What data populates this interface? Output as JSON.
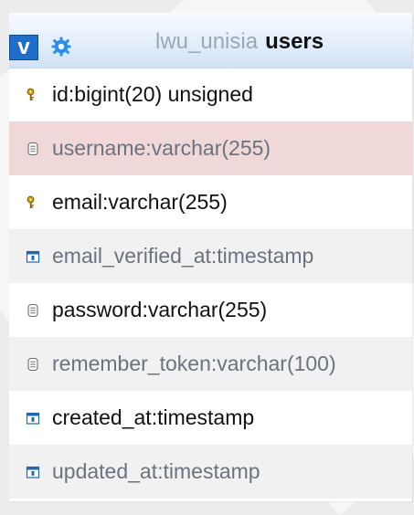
{
  "table": {
    "toggle_label": "v",
    "database": "lwu_unisia",
    "name": "users",
    "header_color": "#2b78d5",
    "primary_key_icon": "key-icon",
    "column_icon": "column-icon",
    "timestamp_icon": "timestamp-icon"
  },
  "columns": [
    {
      "name": "id",
      "type": "bigint(20) unsigned",
      "icon": "key-icon"
    },
    {
      "name": "username",
      "type": "varchar(255)",
      "icon": "column-icon"
    },
    {
      "name": "email",
      "type": "varchar(255)",
      "icon": "key-icon"
    },
    {
      "name": "email_verified_at",
      "type": "timestamp",
      "icon": "timestamp-icon"
    },
    {
      "name": "password",
      "type": "varchar(255)",
      "icon": "column-icon"
    },
    {
      "name": "remember_token",
      "type": "varchar(100)",
      "icon": "column-icon"
    },
    {
      "name": "created_at",
      "type": "timestamp",
      "icon": "timestamp-icon"
    },
    {
      "name": "updated_at",
      "type": "timestamp",
      "icon": "timestamp-icon"
    }
  ]
}
